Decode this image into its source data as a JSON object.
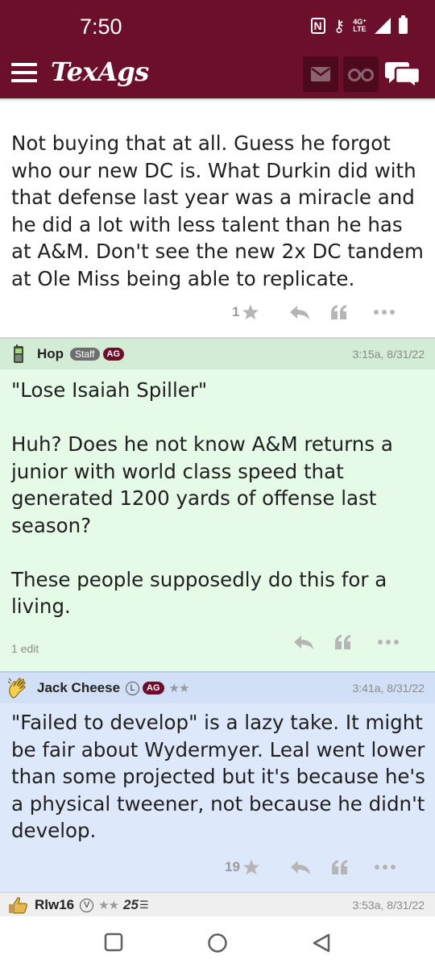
{
  "status_bar": {
    "time": "7:50",
    "network_top": "4G⁺",
    "network_bottom": "LTE"
  },
  "header": {
    "logo": "TexAgs"
  },
  "posts": [
    {
      "body": "Not buying that at all. Guess he forgot who our new DC is. What Durkin did with that defense last year was a miracle and he did a lot with less talent than he has at A&M. Don't see the new 2x DC tandem at Ole Miss being able to replicate.",
      "star_count": "1"
    },
    {
      "username": "Hop",
      "badges": {
        "staff": "Staff",
        "ag": "AG"
      },
      "time": "3:15a, 8/31/22",
      "paragraphs": [
        "\"Lose Isaiah Spiller\"",
        "Huh? Does he not know A&M returns a junior with world class speed that generated 1200 yards of offense last season?",
        "These people supposedly do this for a living."
      ],
      "edit_note": "1 edit"
    },
    {
      "username": "Jack Cheese",
      "badges": {
        "l": "L",
        "ag": "AG",
        "stars": "★★"
      },
      "time": "3:41a, 8/31/22",
      "body": "\"Failed to develop\" is a lazy take. It might be fair about Wydermyer. Leal went lower than some projected but it's because he's a physical tweener, not because he didn't develop.",
      "star_count": "19"
    },
    {
      "username": "Rlw16",
      "badges": {
        "v": "V",
        "stars": "★★",
        "number": "25"
      },
      "time": "3:53a, 8/31/22"
    }
  ],
  "colors": {
    "maroon": "#6b0f2a",
    "staff_bg": "#e6fae8",
    "user_bg": "#dde9fb"
  }
}
